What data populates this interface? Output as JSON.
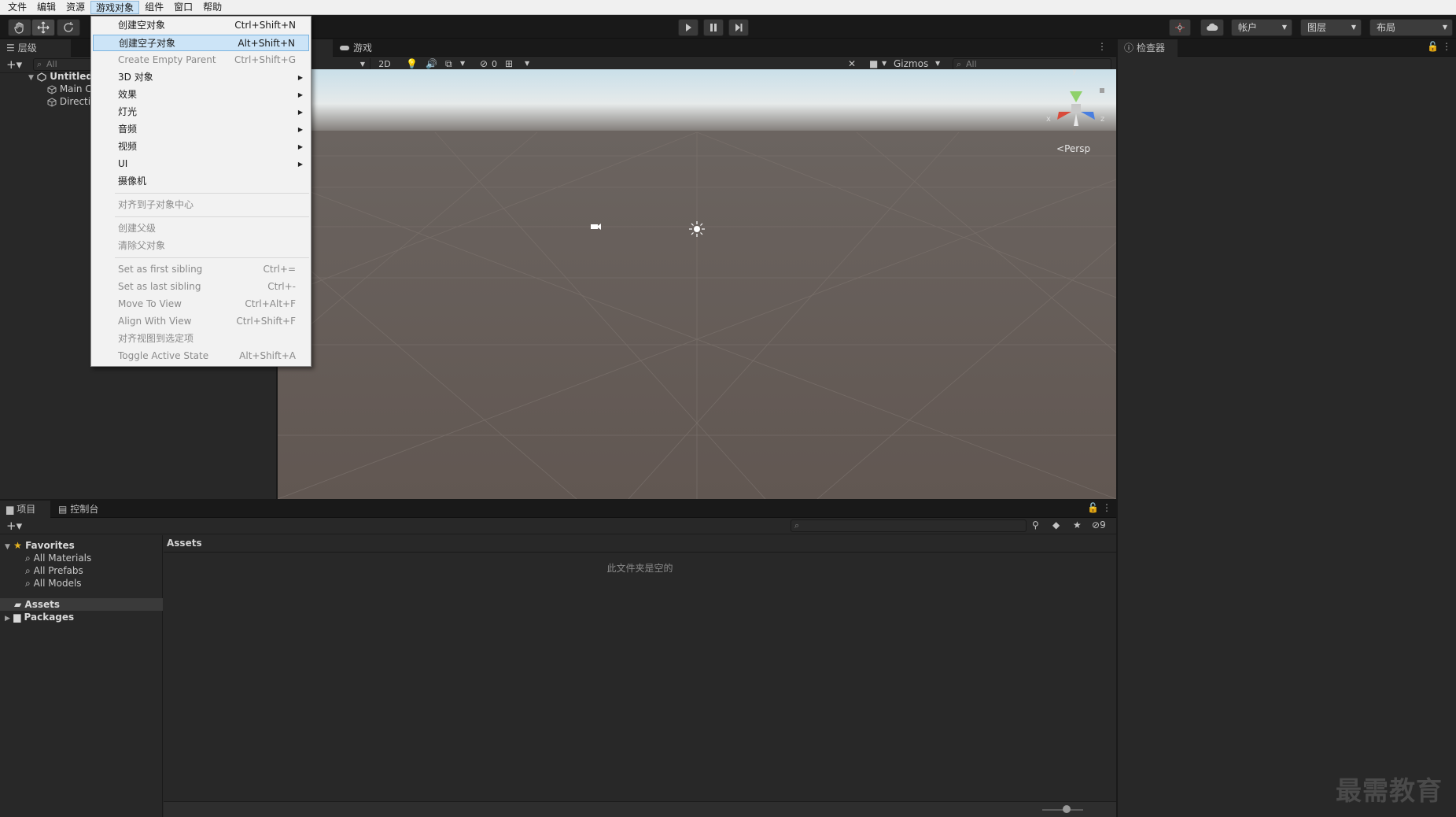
{
  "menubar": {
    "items": [
      "文件",
      "编辑",
      "资源",
      "游戏对象",
      "组件",
      "窗口",
      "帮助"
    ],
    "active_index": 3
  },
  "toolbar": {
    "account_label": "帐户",
    "layers_label": "图层",
    "layout_label": "布局"
  },
  "hierarchy": {
    "tab_label": "层级",
    "search_placeholder": "All",
    "scene_name": "Untitled",
    "items": [
      "Main C",
      "Directi"
    ]
  },
  "scene_view": {
    "game_tab_label": "游戏",
    "btn_2d": "2D",
    "hidden_count": "0",
    "gizmos_label": "Gizmos",
    "search_placeholder": "All",
    "persp_label": "Persp",
    "axis_y": "y",
    "axis_x": "x",
    "axis_z": "z"
  },
  "inspector": {
    "tab_label": "检查器"
  },
  "context_menu": {
    "items": [
      {
        "label": "创建空对象",
        "shortcut": "Ctrl+Shift+N",
        "disabled": false
      },
      {
        "label": "创建空子对象",
        "shortcut": "Alt+Shift+N",
        "disabled": false,
        "highlighted": true
      },
      {
        "label": "Create Empty Parent",
        "shortcut": "Ctrl+Shift+G",
        "disabled": true
      },
      {
        "label": "3D 对象",
        "submenu": true
      },
      {
        "label": "效果",
        "submenu": true
      },
      {
        "label": "灯光",
        "submenu": true
      },
      {
        "label": "音频",
        "submenu": true
      },
      {
        "label": "视频",
        "submenu": true
      },
      {
        "label": "UI",
        "submenu": true
      },
      {
        "label": "摄像机"
      },
      {
        "label": "对齐到子对象中心",
        "disabled": true
      },
      {
        "label": "创建父级",
        "disabled": true
      },
      {
        "label": "清除父对象",
        "disabled": true
      },
      {
        "label": "Set as first sibling",
        "shortcut": "Ctrl+=",
        "disabled": true
      },
      {
        "label": "Set as last sibling",
        "shortcut": "Ctrl+-",
        "disabled": true
      },
      {
        "label": "Move To View",
        "shortcut": "Ctrl+Alt+F",
        "disabled": true
      },
      {
        "label": "Align With View",
        "shortcut": "Ctrl+Shift+F",
        "disabled": true
      },
      {
        "label": "对齐视图到选定项",
        "disabled": true
      },
      {
        "label": "Toggle Active State",
        "shortcut": "Alt+Shift+A",
        "disabled": true
      }
    ]
  },
  "project": {
    "tab_project": "项目",
    "tab_console": "控制台",
    "hidden_packages_count": "9",
    "favorites_label": "Favorites",
    "favorites": [
      "All Materials",
      "All Prefabs",
      "All Models"
    ],
    "assets_label": "Assets",
    "packages_label": "Packages",
    "breadcrumb": "Assets",
    "empty_message": "此文件夹是空的"
  },
  "watermark": "最需教育"
}
